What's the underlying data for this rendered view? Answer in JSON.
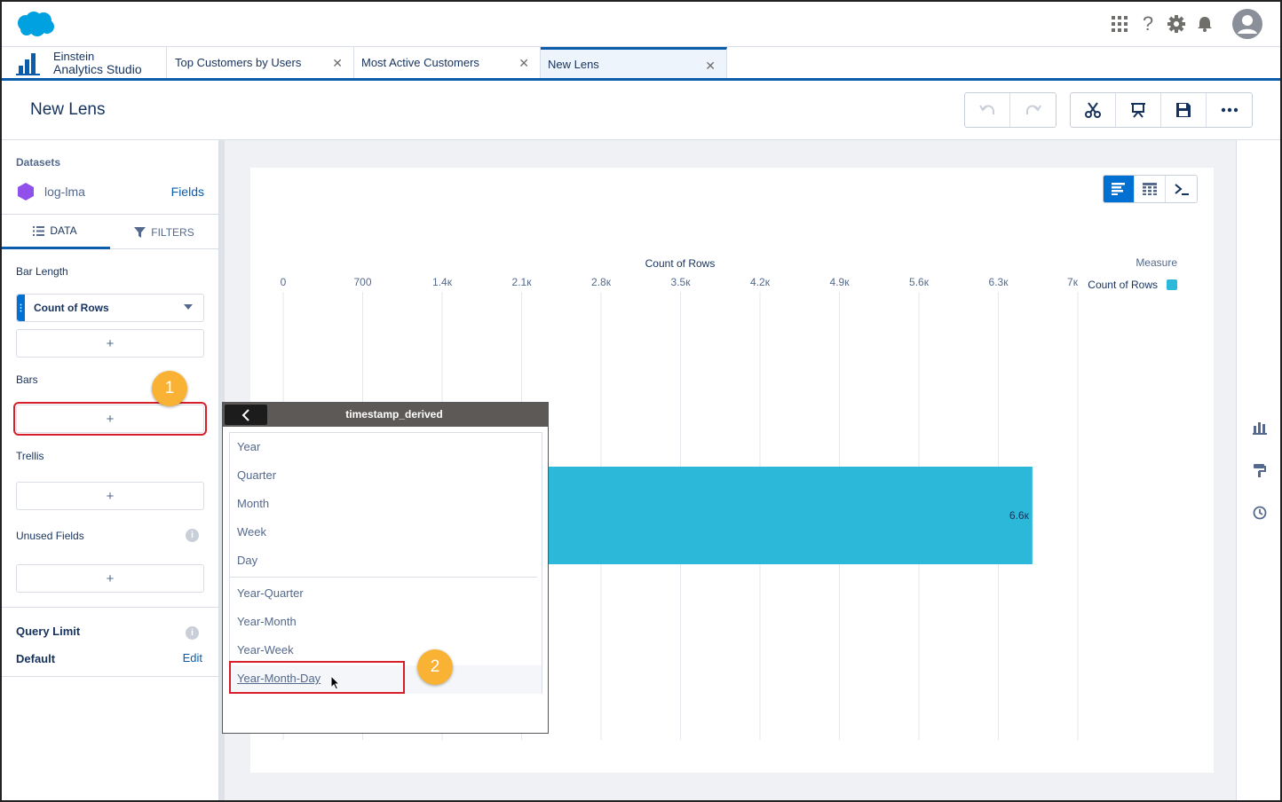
{
  "global_header": {
    "icons": [
      "salesforce-cloud-logo",
      "app-grid-icon",
      "help-icon",
      "settings-icon",
      "notifications-icon",
      "user-avatar-icon"
    ],
    "help_glyph": "?"
  },
  "tabs": {
    "app_name_line1": "Einstein",
    "app_name_line2": "Analytics Studio",
    "items": [
      {
        "label": "Top Customers by Users",
        "close": "✕"
      },
      {
        "label": "Most Active Customers",
        "close": "✕"
      },
      {
        "label": "New Lens",
        "close": "✕",
        "active": true
      }
    ]
  },
  "page": {
    "title": "New Lens",
    "toolbar_icons": [
      "undo-icon",
      "redo-icon",
      "clip-scissors-icon",
      "present-icon",
      "save-icon",
      "more-icon"
    ]
  },
  "left_panel": {
    "datasets_label": "Datasets",
    "dataset_name": "log-lma",
    "fields_link": "Fields",
    "tab_data": "DATA",
    "tab_filters": "FILTERS",
    "bar_length_label": "Bar Length",
    "measure_field": "Count of Rows",
    "bars_label": "Bars",
    "trellis_label": "Trellis",
    "unused_fields_label": "Unused Fields",
    "add_glyph": "+",
    "info_glyph": "i",
    "query_limit_label": "Query Limit",
    "default_label": "Default",
    "edit_link": "Edit"
  },
  "badges": {
    "one": "1",
    "two": "2"
  },
  "popover": {
    "title": "timestamp_derived",
    "items_group1": [
      "Year",
      "Quarter",
      "Month",
      "Week",
      "Day"
    ],
    "items_group2": [
      "Year-Quarter",
      "Year-Month",
      "Year-Week",
      "Year-Month-Day"
    ],
    "selected": "Year-Month-Day"
  },
  "chart_data": {
    "type": "bar",
    "orientation": "horizontal",
    "xlabel": "Count of Rows",
    "tick_labels": [
      "0",
      "700",
      "1.4к",
      "2.1к",
      "2.8к",
      "3.5к",
      "4.2к",
      "4.9к",
      "5.6к",
      "6.3к",
      "7к"
    ],
    "xlim": [
      0,
      7000
    ],
    "legend_title": "Measure",
    "series": [
      {
        "name": "Count of Rows",
        "values": [
          6600
        ],
        "color": "#2bb8d9"
      }
    ],
    "data_labels": [
      "6.6к"
    ],
    "legend_position": "top-right",
    "grid": true
  },
  "colors": {
    "brand_blue": "#0070d2",
    "bar": "#2bb8d9",
    "badge": "#f9b233",
    "highlight": "#d81e2a"
  }
}
